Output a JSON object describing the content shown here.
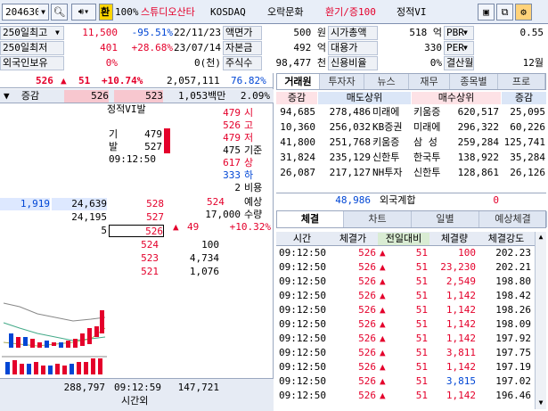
{
  "toolbar": {
    "code": "204630",
    "hwan": "환",
    "pct100": "100%",
    "name": "스튜디오산타",
    "market": "KOSDAQ",
    "sector": "오락문화",
    "margin": "환기/증100",
    "vi_status": "정적VI"
  },
  "info": {
    "rows": [
      {
        "l1": "250일최고",
        "v1a": "11,500",
        "v1b": "-95.51%",
        "v1c": "22/11/23",
        "l2": "액면가",
        "v2": "500 원",
        "l3": "시가총액",
        "v3": "518 억",
        "l4": "PBR",
        "v4": "0.55"
      },
      {
        "l1": "250일최저",
        "v1a": "401",
        "v1b": "+28.68%",
        "v1c": "23/07/14",
        "l2": "자본금",
        "v2": "492 억",
        "l3": "대용가",
        "v3": "330",
        "l4": "PER",
        "v4": ""
      },
      {
        "l1": "외국인보유",
        "v1a": "0%",
        "v1b": "",
        "v1c": "0(천)",
        "l2": "주식수",
        "v2": "98,477 천",
        "l3": "신용비율",
        "v3": "0%",
        "l4": "결산월",
        "v4": "12월"
      }
    ]
  },
  "quote": {
    "price": "526",
    "change": "51",
    "rate": "+10.74%",
    "volume": "2,057,111",
    "vol_pct": "76.82%",
    "amount": "1,053백만",
    "turnover": "2.09%",
    "col_label": "증감",
    "ref_price1": "526",
    "ref_price2": "523"
  },
  "vi": {
    "title": "정적VI발",
    "base_label": "기",
    "base_val": "479",
    "trig_label": "발",
    "trig_val": "527",
    "time": "09:12:50"
  },
  "ohlc": [
    {
      "val": "479",
      "label": "시"
    },
    {
      "val": "526",
      "label": "고"
    },
    {
      "val": "479",
      "label": "저"
    },
    {
      "val": "475",
      "label": "기준"
    },
    {
      "val": "617",
      "label": "상"
    },
    {
      "val": "333",
      "label": "하"
    },
    {
      "val": "2",
      "label": "비용"
    }
  ],
  "asks": [
    {
      "chg": "1,919",
      "qty": "24,639",
      "price": "528"
    },
    {
      "chg": "",
      "qty": "24,195",
      "price": "527"
    },
    {
      "chg": "",
      "qty": "5",
      "price": "526"
    }
  ],
  "expected": {
    "price": "524",
    "price_label": "예상",
    "qty": "17,000",
    "qty_label": "수량",
    "chg": "49",
    "rate": "+10.32%"
  },
  "bids": [
    {
      "price": "524",
      "qty": "100"
    },
    {
      "price": "523",
      "qty": "4,734"
    },
    {
      "price": "521",
      "qty": "1,076"
    }
  ],
  "bottom": {
    "ask_total": "288,797",
    "time": "09:12:59",
    "bid_total": "147,721",
    "after_label": "시간외"
  },
  "broker": {
    "tabs": [
      "거래원",
      "투자자",
      "뉴스",
      "재무",
      "종목별",
      "프로"
    ],
    "sell_hdr_chg": "증감",
    "sell_hdr": "매도상위",
    "buy_hdr": "매수상위",
    "buy_hdr_chg": "증감",
    "rows": [
      {
        "sc": "94,685",
        "sq": "278,486",
        "sn": "미래에",
        "bn": "키움증",
        "bq": "620,517",
        "bc": "25,095"
      },
      {
        "sc": "10,360",
        "sq": "256,032",
        "sn": "KB증권",
        "bn": "미래에",
        "bq": "296,322",
        "bc": "60,226"
      },
      {
        "sc": "41,800",
        "sq": "251,768",
        "sn": "키움증",
        "bn": "삼 성",
        "bq": "259,284",
        "bc": "125,741"
      },
      {
        "sc": "31,824",
        "sq": "235,129",
        "sn": "신한투",
        "bn": "한국투",
        "bq": "138,922",
        "bc": "35,284"
      },
      {
        "sc": "26,087",
        "sq": "217,127",
        "sn": "NH투자",
        "bn": "신한투",
        "bq": "128,861",
        "bc": "26,126"
      }
    ],
    "foreign_val": "48,986",
    "foreign_label": "외국계합",
    "foreign_buy": "0"
  },
  "trades": {
    "tabs": [
      "체결",
      "차트",
      "일별",
      "예상체결"
    ],
    "headers": [
      "시간",
      "체결가",
      "전일대비",
      "체결량",
      "체결강도"
    ],
    "rows": [
      {
        "t": "09:12:50",
        "p": "526",
        "c": "51",
        "q": "100",
        "s": "202.23",
        "qc": "red"
      },
      {
        "t": "09:12:50",
        "p": "526",
        "c": "51",
        "q": "23,230",
        "s": "202.21",
        "qc": "red"
      },
      {
        "t": "09:12:50",
        "p": "526",
        "c": "51",
        "q": "2,549",
        "s": "198.80",
        "qc": "red"
      },
      {
        "t": "09:12:50",
        "p": "526",
        "c": "51",
        "q": "1,142",
        "s": "198.42",
        "qc": "red"
      },
      {
        "t": "09:12:50",
        "p": "526",
        "c": "51",
        "q": "1,142",
        "s": "198.26",
        "qc": "red"
      },
      {
        "t": "09:12:50",
        "p": "526",
        "c": "51",
        "q": "1,142",
        "s": "198.09",
        "qc": "red"
      },
      {
        "t": "09:12:50",
        "p": "526",
        "c": "51",
        "q": "1,142",
        "s": "197.92",
        "qc": "red"
      },
      {
        "t": "09:12:50",
        "p": "526",
        "c": "51",
        "q": "3,811",
        "s": "197.75",
        "qc": "red"
      },
      {
        "t": "09:12:50",
        "p": "526",
        "c": "51",
        "q": "1,142",
        "s": "197.19",
        "qc": "red"
      },
      {
        "t": "09:12:50",
        "p": "526",
        "c": "51",
        "q": "3,815",
        "s": "197.02",
        "qc": "blue"
      },
      {
        "t": "09:12:50",
        "p": "526",
        "c": "51",
        "q": "1,142",
        "s": "196.46",
        "qc": "red"
      }
    ]
  },
  "colors": {
    "up": "#e4002b",
    "down": "#0046d5",
    "header_bg": "#e6ebf4"
  },
  "icons": [
    "search-icon",
    "speaker-icon",
    "dropdown-icon",
    "window-icon",
    "copy-icon",
    "settings-icon",
    "arrow-up-icon"
  ]
}
